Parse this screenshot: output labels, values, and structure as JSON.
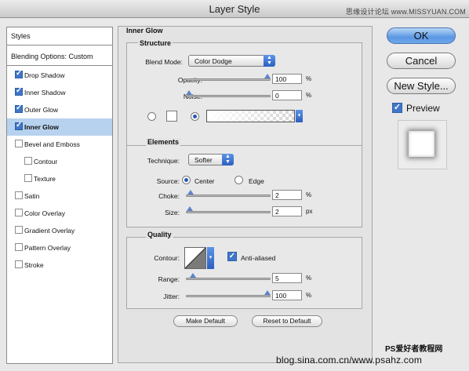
{
  "window": {
    "title": "Layer Style",
    "watermark_top": "思缘设计论坛 www.MISSYUAN.COM"
  },
  "left_panel": {
    "styles_header": "Styles",
    "blending_header": "Blending Options: Custom",
    "items": [
      {
        "label": "Drop Shadow",
        "checked": true,
        "selected": false,
        "indent": false
      },
      {
        "label": "Inner Shadow",
        "checked": true,
        "selected": false,
        "indent": false
      },
      {
        "label": "Outer Glow",
        "checked": true,
        "selected": false,
        "indent": false
      },
      {
        "label": "Inner Glow",
        "checked": true,
        "selected": true,
        "indent": false
      },
      {
        "label": "Bevel and Emboss",
        "checked": false,
        "selected": false,
        "indent": false
      },
      {
        "label": "Contour",
        "checked": false,
        "selected": false,
        "indent": true
      },
      {
        "label": "Texture",
        "checked": false,
        "selected": false,
        "indent": true
      },
      {
        "label": "Satin",
        "checked": false,
        "selected": false,
        "indent": false
      },
      {
        "label": "Color Overlay",
        "checked": false,
        "selected": false,
        "indent": false
      },
      {
        "label": "Gradient Overlay",
        "checked": false,
        "selected": false,
        "indent": false
      },
      {
        "label": "Pattern Overlay",
        "checked": false,
        "selected": false,
        "indent": false
      },
      {
        "label": "Stroke",
        "checked": false,
        "selected": false,
        "indent": false
      }
    ]
  },
  "main": {
    "title": "Inner Glow",
    "structure": {
      "title": "Structure",
      "blend_mode_label": "Blend Mode:",
      "blend_mode_value": "Color Dodge",
      "opacity_label": "Opacity:",
      "opacity_value": "100",
      "opacity_level": 1.0,
      "noise_label": "Noise:",
      "noise_value": "0",
      "noise_level": 0.0,
      "percent": "%"
    },
    "elements": {
      "title": "Elements",
      "technique_label": "Technique:",
      "technique_value": "Softer",
      "source_label": "Source:",
      "source_center": "Center",
      "source_edge": "Edge",
      "choke_label": "Choke:",
      "choke_value": "2",
      "choke_level": 0.02,
      "size_label": "Size:",
      "size_value": "2",
      "size_level": 0.01,
      "percent": "%",
      "px": "px"
    },
    "quality": {
      "title": "Quality",
      "contour_label": "Contour:",
      "anti_aliased_label": "Anti-aliased",
      "range_label": "Range:",
      "range_value": "5",
      "range_level": 0.05,
      "jitter_label": "Jitter:",
      "jitter_value": "100",
      "jitter_level": 1.0,
      "percent": "%"
    },
    "make_default": "Make Default",
    "reset_default": "Reset to Default"
  },
  "right": {
    "ok": "OK",
    "cancel": "Cancel",
    "new_style": "New Style...",
    "preview_label": "Preview"
  },
  "watermarks": {
    "bottom_right": "PS爱好者教程网",
    "bottom": "blog.sina.com.cn/www.psahz.com"
  },
  "colors": {
    "accent": "#5b98e3",
    "selection": "#b7d2ee"
  }
}
